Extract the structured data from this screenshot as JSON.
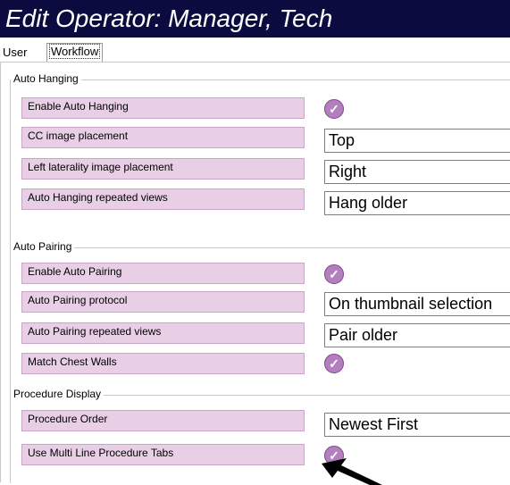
{
  "title": "Edit Operator: Manager, Tech",
  "tabs": [
    {
      "label": "User"
    },
    {
      "label": "Workflow",
      "selected": true
    }
  ],
  "groups": [
    {
      "title": "Auto Hanging",
      "rows": [
        {
          "label": "Enable Auto Hanging",
          "type": "checkbox",
          "checked": true
        },
        {
          "label": "CC image placement",
          "type": "select",
          "value": "Top"
        },
        {
          "label": "Left laterality image placement",
          "type": "select",
          "value": "Right"
        },
        {
          "label": "Auto Hanging repeated views",
          "type": "select",
          "value": "Hang older"
        }
      ]
    },
    {
      "title": "Auto Pairing",
      "rows": [
        {
          "label": "Enable Auto Pairing",
          "type": "checkbox",
          "checked": true
        },
        {
          "label": "Auto Pairing protocol",
          "type": "select",
          "value": "On thumbnail selection"
        },
        {
          "label": "Auto Pairing repeated views",
          "type": "select",
          "value": "Pair older"
        },
        {
          "label": "Match Chest Walls",
          "type": "checkbox",
          "checked": true
        }
      ]
    },
    {
      "title": "Procedure Display",
      "rows": [
        {
          "label": "Procedure Order",
          "type": "select",
          "value": "Newest First"
        },
        {
          "label": "Use Multi Line Procedure Tabs",
          "type": "checkbox",
          "checked": true
        }
      ]
    }
  ],
  "icons": {
    "check": "checkmark-icon",
    "arrow": "pointer-arrow-icon"
  },
  "colors": {
    "titlebar": "#0b0b3f",
    "label_bg": "#e8cfe6",
    "checkbox": "#b47fbe"
  }
}
